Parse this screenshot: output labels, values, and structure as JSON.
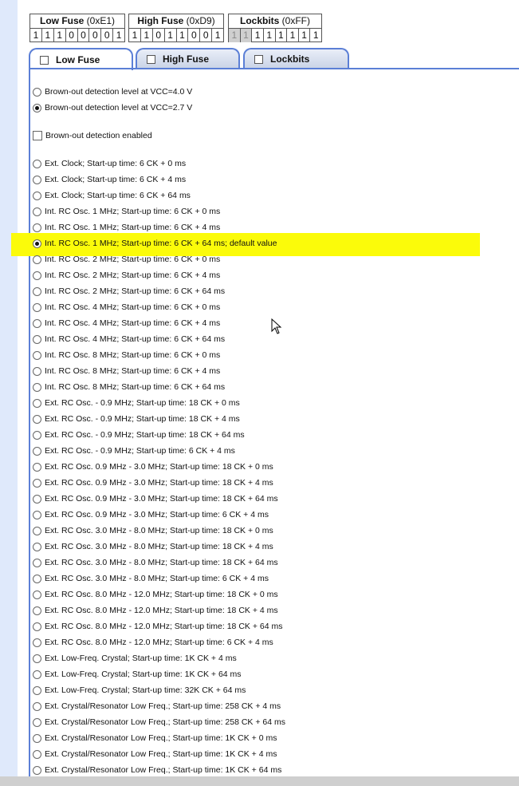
{
  "fuses": [
    {
      "name": "Low Fuse",
      "hex": "(0xE1)",
      "bits": [
        "1",
        "1",
        "1",
        "0",
        "0",
        "0",
        "0",
        "1"
      ],
      "disabled_bits": []
    },
    {
      "name": "High Fuse",
      "hex": "(0xD9)",
      "bits": [
        "1",
        "1",
        "0",
        "1",
        "1",
        "0",
        "0",
        "1"
      ],
      "disabled_bits": []
    },
    {
      "name": "Lockbits",
      "hex": "(0xFF)",
      "bits": [
        "1",
        "1",
        "1",
        "1",
        "1",
        "1",
        "1",
        "1"
      ],
      "disabled_bits": [
        0,
        1
      ]
    }
  ],
  "tabs": [
    {
      "label": "Low Fuse",
      "active": true
    },
    {
      "label": "High Fuse",
      "active": false
    },
    {
      "label": "Lockbits",
      "active": false
    }
  ],
  "bod_levels": [
    {
      "label": "Brown-out detection level at VCC=4.0 V",
      "checked": false
    },
    {
      "label": "Brown-out detection level at VCC=2.7 V",
      "checked": true
    }
  ],
  "bod_enable": {
    "label": "Brown-out detection enabled",
    "checked": false
  },
  "clock_options": [
    {
      "label": "Ext. Clock; Start-up time: 6 CK + 0 ms",
      "checked": false
    },
    {
      "label": "Ext. Clock; Start-up time: 6 CK + 4 ms",
      "checked": false
    },
    {
      "label": "Ext. Clock; Start-up time: 6 CK + 64 ms",
      "checked": false
    },
    {
      "label": "Int. RC Osc. 1 MHz; Start-up time: 6 CK + 0 ms",
      "checked": false
    },
    {
      "label": "Int. RC Osc. 1 MHz; Start-up time: 6 CK + 4 ms",
      "checked": false
    },
    {
      "label": "Int. RC Osc. 1 MHz; Start-up time: 6 CK + 64 ms; default value",
      "checked": true
    },
    {
      "label": "Int. RC Osc. 2 MHz; Start-up time: 6 CK + 0 ms",
      "checked": false
    },
    {
      "label": "Int. RC Osc. 2 MHz; Start-up time: 6 CK + 4 ms",
      "checked": false
    },
    {
      "label": "Int. RC Osc. 2 MHz; Start-up time: 6 CK + 64 ms",
      "checked": false
    },
    {
      "label": "Int. RC Osc. 4 MHz; Start-up time: 6 CK + 0 ms",
      "checked": false
    },
    {
      "label": "Int. RC Osc. 4 MHz; Start-up time: 6 CK + 4 ms",
      "checked": false
    },
    {
      "label": "Int. RC Osc. 4 MHz; Start-up time: 6 CK + 64 ms",
      "checked": false
    },
    {
      "label": "Int. RC Osc. 8 MHz; Start-up time: 6 CK + 0 ms",
      "checked": false
    },
    {
      "label": "Int. RC Osc. 8 MHz; Start-up time: 6 CK + 4 ms",
      "checked": false
    },
    {
      "label": "Int. RC Osc. 8 MHz; Start-up time: 6 CK + 64 ms",
      "checked": false
    },
    {
      "label": "Ext. RC Osc. - 0.9 MHz; Start-up time: 18 CK + 0 ms",
      "checked": false
    },
    {
      "label": "Ext. RC Osc. - 0.9 MHz; Start-up time: 18 CK + 4 ms",
      "checked": false
    },
    {
      "label": "Ext. RC Osc. - 0.9 MHz; Start-up time: 18 CK + 64 ms",
      "checked": false
    },
    {
      "label": "Ext. RC Osc. - 0.9 MHz; Start-up time: 6 CK + 4 ms",
      "checked": false
    },
    {
      "label": "Ext. RC Osc. 0.9 MHz - 3.0 MHz; Start-up time: 18 CK + 0 ms",
      "checked": false
    },
    {
      "label": "Ext. RC Osc. 0.9 MHz - 3.0 MHz; Start-up time: 18 CK + 4 ms",
      "checked": false
    },
    {
      "label": "Ext. RC Osc. 0.9 MHz - 3.0 MHz; Start-up time: 18 CK + 64 ms",
      "checked": false
    },
    {
      "label": "Ext. RC Osc. 0.9 MHz - 3.0 MHz; Start-up time: 6 CK + 4 ms",
      "checked": false
    },
    {
      "label": "Ext. RC Osc. 3.0 MHz - 8.0 MHz; Start-up time: 18 CK + 0 ms",
      "checked": false
    },
    {
      "label": "Ext. RC Osc. 3.0 MHz - 8.0 MHz; Start-up time: 18 CK + 4 ms",
      "checked": false
    },
    {
      "label": "Ext. RC Osc. 3.0 MHz - 8.0 MHz; Start-up time: 18 CK + 64 ms",
      "checked": false
    },
    {
      "label": "Ext. RC Osc. 3.0 MHz - 8.0 MHz; Start-up time: 6 CK + 4 ms",
      "checked": false
    },
    {
      "label": "Ext. RC Osc. 8.0 MHz - 12.0 MHz; Start-up time: 18 CK + 0 ms",
      "checked": false
    },
    {
      "label": "Ext. RC Osc. 8.0 MHz - 12.0 MHz; Start-up time: 18 CK + 4 ms",
      "checked": false
    },
    {
      "label": "Ext. RC Osc. 8.0 MHz - 12.0 MHz; Start-up time: 18 CK + 64 ms",
      "checked": false
    },
    {
      "label": "Ext. RC Osc. 8.0 MHz - 12.0 MHz; Start-up time: 6 CK + 4 ms",
      "checked": false
    },
    {
      "label": "Ext. Low-Freq. Crystal; Start-up time: 1K CK + 4 ms",
      "checked": false
    },
    {
      "label": "Ext. Low-Freq. Crystal; Start-up time: 1K CK + 64 ms",
      "checked": false
    },
    {
      "label": "Ext. Low-Freq. Crystal; Start-up time: 32K CK + 64 ms",
      "checked": false
    },
    {
      "label": "Ext. Crystal/Resonator Low Freq.; Start-up time: 258 CK + 4 ms",
      "checked": false
    },
    {
      "label": "Ext. Crystal/Resonator Low Freq.; Start-up time: 258 CK + 64 ms",
      "checked": false
    },
    {
      "label": "Ext. Crystal/Resonator Low Freq.; Start-up time: 1K CK + 0 ms",
      "checked": false
    },
    {
      "label": "Ext. Crystal/Resonator Low Freq.; Start-up time: 1K CK + 4 ms",
      "checked": false
    },
    {
      "label": "Ext. Crystal/Resonator Low Freq.; Start-up time: 1K CK + 64 ms",
      "checked": false
    }
  ],
  "colors": {
    "accent": "#5b7fd6",
    "highlight": "#fbfb0a",
    "stripe": "#dfe9fb"
  }
}
